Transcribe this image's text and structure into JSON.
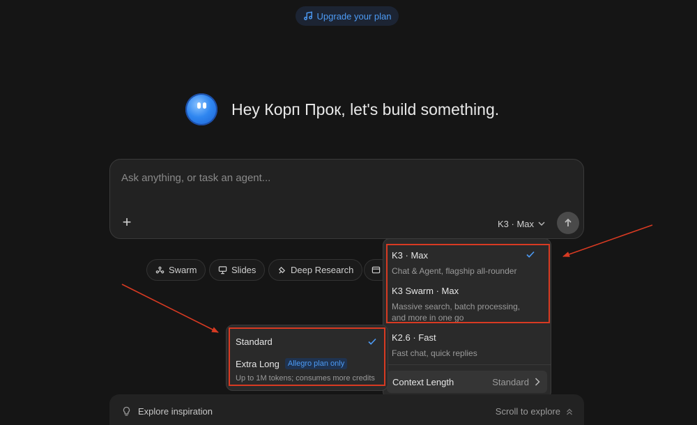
{
  "header": {
    "upgrade_label": "Upgrade your plan"
  },
  "greeting": {
    "text": "Hey Корп Прок, let's build something."
  },
  "composer": {
    "placeholder": "Ask anything, or task an agent...",
    "model_selected": "K3 · Max"
  },
  "chips": [
    {
      "label": "Swarm"
    },
    {
      "label": "Slides"
    },
    {
      "label": "Deep Research"
    }
  ],
  "model_menu": {
    "items": [
      {
        "title": "K3 · Max",
        "desc": "Chat & Agent, flagship all-rounder",
        "selected": true
      },
      {
        "title": "K3 Swarm · Max",
        "desc_line1": "Massive search, batch processing,",
        "desc_line2": "and more in one go"
      },
      {
        "title": "K2.6 · Fast",
        "desc": "Fast chat, quick replies"
      }
    ],
    "context_label": "Context Length",
    "context_value": "Standard"
  },
  "context_menu": {
    "standard_label": "Standard",
    "extra_long_label": "Extra Long",
    "extra_long_badge": "Allegro plan only",
    "extra_long_desc": "Up to 1M tokens; consumes more credits"
  },
  "explore": {
    "left_label": "Explore inspiration",
    "right_label": "Scroll to explore"
  },
  "colors": {
    "background": "#151515",
    "accent": "#4d9bf5",
    "annotation": "#d83a22"
  }
}
